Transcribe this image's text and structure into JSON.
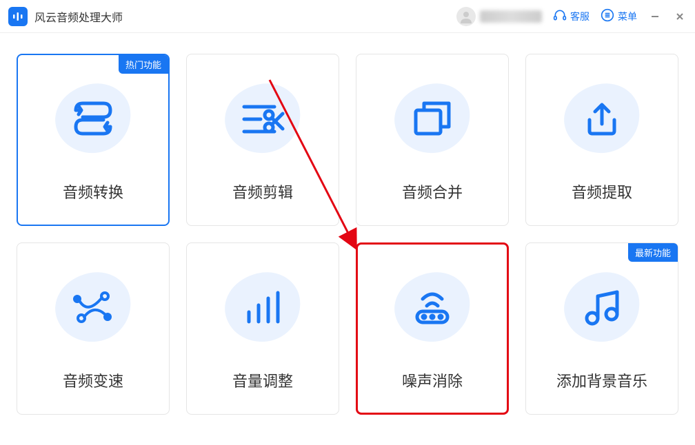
{
  "app": {
    "title": "风云音频处理大师"
  },
  "titlebar": {
    "customer_service": "客服",
    "menu": "菜单"
  },
  "badges": {
    "hot": "热门功能",
    "new": "最新功能"
  },
  "cards": [
    {
      "id": "audio-convert",
      "label": "音频转换",
      "badge": "hot",
      "selected": true
    },
    {
      "id": "audio-clip",
      "label": "音频剪辑"
    },
    {
      "id": "audio-merge",
      "label": "音频合并"
    },
    {
      "id": "audio-extract",
      "label": "音频提取"
    },
    {
      "id": "audio-speed",
      "label": "音频变速"
    },
    {
      "id": "volume-adjust",
      "label": "音量调整"
    },
    {
      "id": "noise-remove",
      "label": "噪声消除",
      "highlight": true
    },
    {
      "id": "add-bgm",
      "label": "添加背景音乐",
      "badge": "new"
    }
  ],
  "colors": {
    "primary": "#1976f2",
    "highlight": "#e30613"
  }
}
